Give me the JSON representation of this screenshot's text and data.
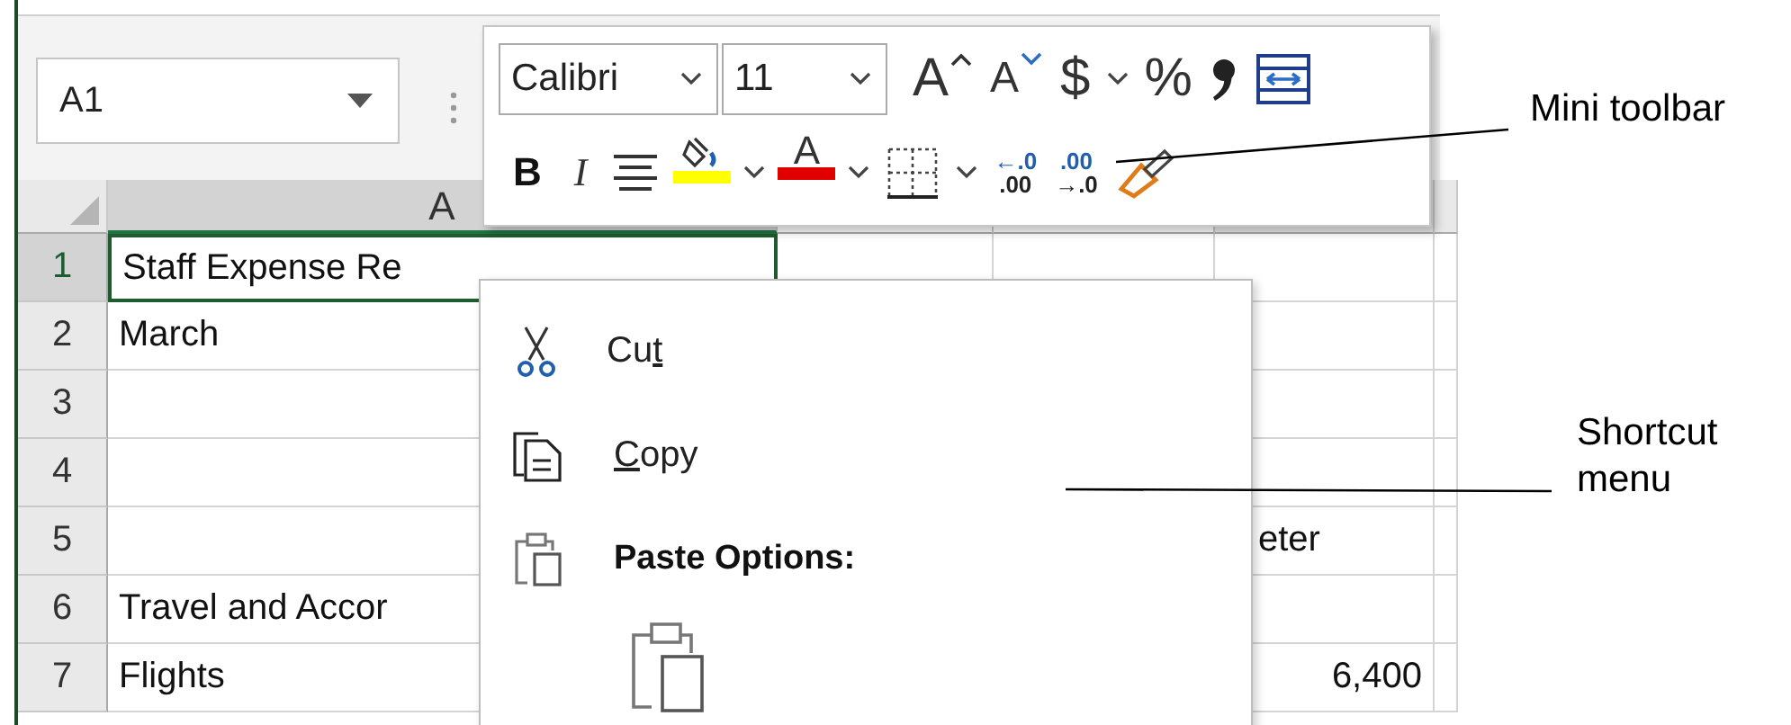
{
  "name_box": {
    "value": "A1"
  },
  "mini_toolbar": {
    "font_name": "Calibri",
    "font_size": "11",
    "row_1": [
      {
        "kind": "grow-font",
        "label": "A"
      },
      {
        "kind": "shrink-font",
        "label": "A"
      },
      {
        "kind": "currency",
        "label": "$"
      },
      {
        "kind": "dropdown"
      },
      {
        "kind": "percent",
        "label": "%"
      },
      {
        "kind": "comma"
      },
      {
        "kind": "merge"
      }
    ],
    "row_2": [
      {
        "kind": "bold",
        "label": "B"
      },
      {
        "kind": "italic",
        "label": "I"
      },
      {
        "kind": "align"
      },
      {
        "kind": "fill-color",
        "color": "#ffff00"
      },
      {
        "kind": "dropdown"
      },
      {
        "kind": "font-color",
        "label": "A",
        "color": "#e00000"
      },
      {
        "kind": "dropdown"
      },
      {
        "kind": "borders"
      },
      {
        "kind": "dropdown"
      },
      {
        "kind": "decimal",
        "top": "←.0",
        "bottom": ".00"
      },
      {
        "kind": "decimal",
        "top": ".00",
        "bottom": "→.0"
      },
      {
        "kind": "painter"
      }
    ]
  },
  "sheet": {
    "columns": [
      {
        "label": "A",
        "selected": true
      }
    ],
    "rows": [
      {
        "header": "1",
        "selected": true,
        "column_1": "Staff Expense Re"
      },
      {
        "header": "2",
        "selected": false,
        "column_1": "March"
      },
      {
        "header": "3",
        "selected": false
      },
      {
        "header": "4",
        "selected": false
      },
      {
        "header": "5",
        "selected": false,
        "column_4": "eter"
      },
      {
        "header": "6",
        "selected": false,
        "column_1": "Travel and Accor"
      },
      {
        "header": "7",
        "selected": false,
        "column_1": "Flights",
        "column_4": "6,400"
      }
    ]
  },
  "shortcut_menu": {
    "items": [
      {
        "kind": "cut",
        "before": "Cu",
        "mnemonic": "t"
      },
      {
        "kind": "copy",
        "mnemonic": "C",
        "after": "opy"
      },
      {
        "kind": "heading",
        "label": "Paste Options:"
      },
      {
        "kind": "paste-option"
      }
    ]
  },
  "callouts": [
    {
      "label": "Mini toolbar"
    },
    {
      "label": "Shortcut menu"
    }
  ]
}
